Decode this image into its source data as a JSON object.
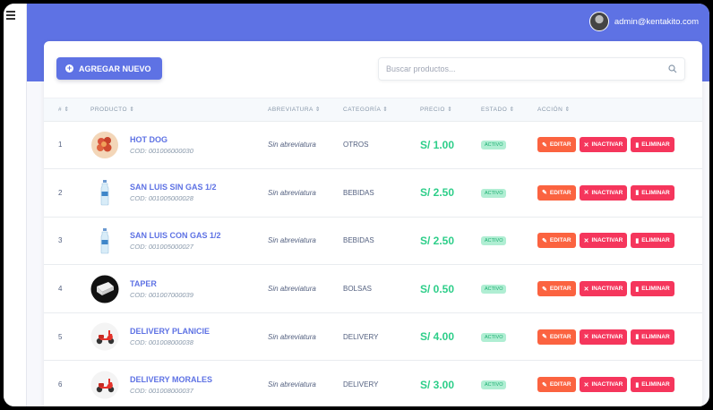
{
  "header": {
    "user_email": "admin@kentakito.com"
  },
  "toolbar": {
    "add_label": "AGREGAR NUEVO",
    "search_placeholder": "Buscar productos..."
  },
  "table": {
    "columns": [
      "#",
      "PRODUCTO",
      "ABREVIATURA",
      "CATEGORÍA",
      "PRECIO",
      "ESTADO",
      "ACCIÓN"
    ],
    "sort_glyph": "⇕",
    "action_labels": {
      "edit": "EDITAR",
      "inactivate": "INACTIVAR",
      "delete": "ELIMINAR"
    },
    "rows": [
      {
        "num": "1",
        "name": "HOT DOG",
        "code": "COD: 001006000030",
        "abbr": "Sin abreviatura",
        "category": "OTROS",
        "price": "S/ 1.00",
        "status": "ACTIVO",
        "icon": "hotdog-image"
      },
      {
        "num": "2",
        "name": "SAN LUIS SIN GAS 1/2",
        "code": "COD: 001005000028",
        "abbr": "Sin abreviatura",
        "category": "BEBIDAS",
        "price": "S/ 2.50",
        "status": "ACTIVO",
        "icon": "water-bottle-image"
      },
      {
        "num": "3",
        "name": "SAN LUIS CON GAS 1/2",
        "code": "COD: 001005000027",
        "abbr": "Sin abreviatura",
        "category": "BEBIDAS",
        "price": "S/ 2.50",
        "status": "ACTIVO",
        "icon": "water-bottle-image"
      },
      {
        "num": "4",
        "name": "TAPER",
        "code": "COD: 001007000039",
        "abbr": "Sin abreviatura",
        "category": "BOLSAS",
        "price": "S/ 0.50",
        "status": "ACTIVO",
        "icon": "taper-image"
      },
      {
        "num": "5",
        "name": "DELIVERY PLANICIE",
        "code": "COD: 001008000038",
        "abbr": "Sin abreviatura",
        "category": "DELIVERY",
        "price": "S/ 4.00",
        "status": "ACTIVO",
        "icon": "scooter-image"
      },
      {
        "num": "6",
        "name": "DELIVERY MORALES",
        "code": "COD: 001008000037",
        "abbr": "Sin abreviatura",
        "category": "DELIVERY",
        "price": "S/ 3.00",
        "status": "ACTIVO",
        "icon": "scooter-image"
      }
    ]
  },
  "colors": {
    "primary": "#5e72e4",
    "success": "#2dce89",
    "warning": "#fb6340",
    "danger": "#f5365c"
  }
}
